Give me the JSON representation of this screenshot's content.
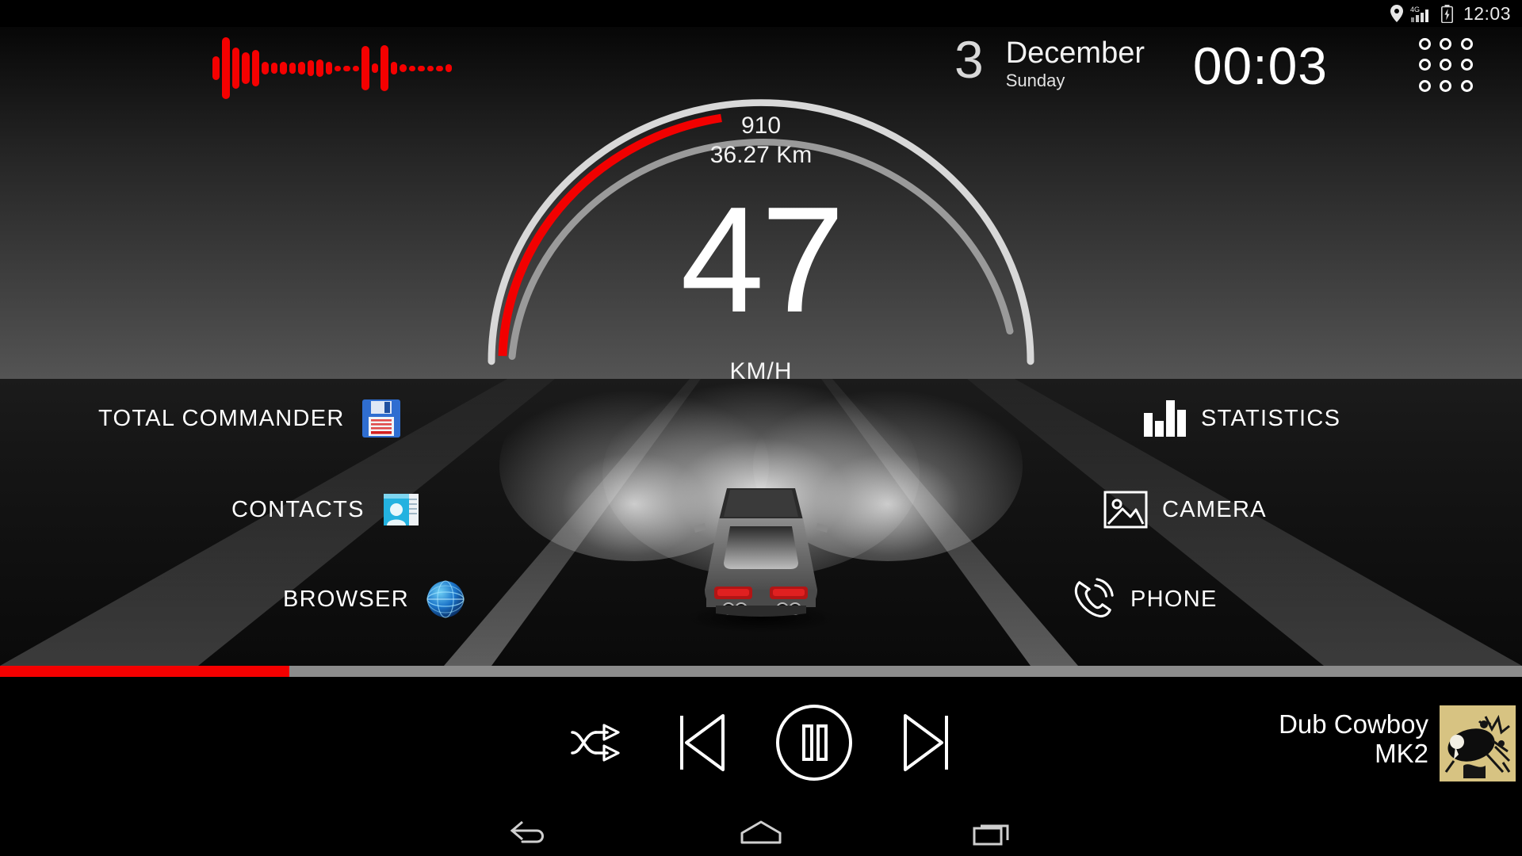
{
  "status_bar": {
    "icons": [
      "location-pin-icon",
      "mobile-signal-4g-icon",
      "battery-charging-icon"
    ],
    "network_label": "4G",
    "time": "12:03"
  },
  "visualizer": {
    "name": "audio-spectrum-visualizer",
    "color": "#f50000",
    "bars": [
      30,
      78,
      52,
      40,
      46,
      16,
      14,
      16,
      14,
      16,
      20,
      22,
      16,
      7,
      7,
      7,
      56,
      12,
      58,
      16,
      10,
      7,
      7,
      7,
      7,
      10
    ]
  },
  "gauge": {
    "rpm": "910",
    "distance": "36.27 Km",
    "speed": "47",
    "unit": "KM/H",
    "progress_color": "#f20000",
    "track_color": "#d8d8d8",
    "inner_track_color": "#9c9c9c"
  },
  "date_widget": {
    "day": "3",
    "month": "December",
    "weekday": "Sunday"
  },
  "clock": {
    "time": "00:03"
  },
  "app_drawer": {
    "label": "app-drawer",
    "icon": "grid-dots-icon"
  },
  "shortcuts": {
    "left": [
      {
        "label": "TOTAL COMMANDER",
        "icon": "floppy-disk-icon"
      },
      {
        "label": "CONTACTS",
        "icon": "contacts-card-icon"
      },
      {
        "label": "BROWSER",
        "icon": "globe-icon"
      }
    ],
    "right": [
      {
        "label": "STATISTICS",
        "icon": "bar-chart-icon"
      },
      {
        "label": "CAMERA",
        "icon": "photo-frame-icon"
      },
      {
        "label": "PHONE",
        "icon": "phone-handset-icon"
      }
    ]
  },
  "media": {
    "progress_percent": 19,
    "progress_color": "#f40000",
    "track_color": "#8c8c8c",
    "controls": [
      {
        "name": "shuffle-button",
        "icon": "shuffle-icon"
      },
      {
        "name": "previous-button",
        "icon": "skip-previous-icon"
      },
      {
        "name": "play-pause-button",
        "icon": "pause-circle-icon"
      },
      {
        "name": "next-button",
        "icon": "skip-next-icon"
      }
    ],
    "track_title": "Dub Cowboy",
    "track_album": "MK2",
    "album_art": "album-art-tan-ink-splatter"
  },
  "nav_bar": {
    "buttons": [
      {
        "name": "back-button",
        "icon": "back-arrow-icon"
      },
      {
        "name": "home-button",
        "icon": "home-icon"
      },
      {
        "name": "recents-button",
        "icon": "recents-icon"
      }
    ]
  }
}
